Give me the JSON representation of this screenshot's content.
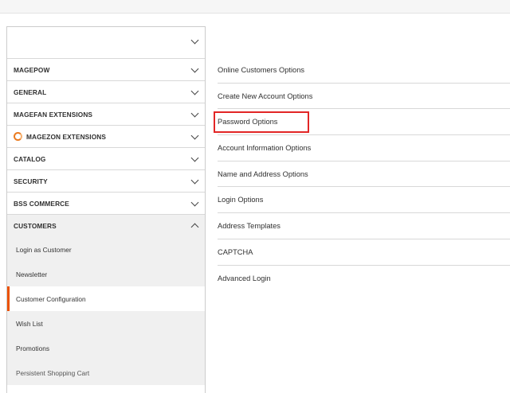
{
  "sidebar": {
    "sections": [
      {
        "label": "MAGEPOW"
      },
      {
        "label": "GENERAL"
      },
      {
        "label": "MAGEFAN EXTENSIONS"
      },
      {
        "label": "MAGEZON EXTENSIONS",
        "icon": "magezon-logo-icon"
      },
      {
        "label": "CATALOG"
      },
      {
        "label": "SECURITY"
      },
      {
        "label": "BSS COMMERCE"
      }
    ],
    "open_section": {
      "label": "CUSTOMERS",
      "items": [
        {
          "label": "Login as Customer"
        },
        {
          "label": "Newsletter"
        },
        {
          "label": "Customer Configuration",
          "active": true
        },
        {
          "label": "Wish List"
        },
        {
          "label": "Promotions"
        },
        {
          "label": "Persistent Shopping Cart"
        }
      ]
    }
  },
  "main": {
    "groups": [
      {
        "label": "Online Customers Options"
      },
      {
        "label": "Create New Account Options"
      },
      {
        "label": "Password Options",
        "highlighted": true
      },
      {
        "label": "Account Information Options"
      },
      {
        "label": "Name and Address Options"
      },
      {
        "label": "Login Options"
      },
      {
        "label": "Address Templates"
      },
      {
        "label": "CAPTCHA"
      },
      {
        "label": "Advanced Login"
      }
    ]
  },
  "colors": {
    "accent": "#eb5202",
    "highlight_border": "#e22626",
    "magezon_icon": "#eb7a1f"
  }
}
